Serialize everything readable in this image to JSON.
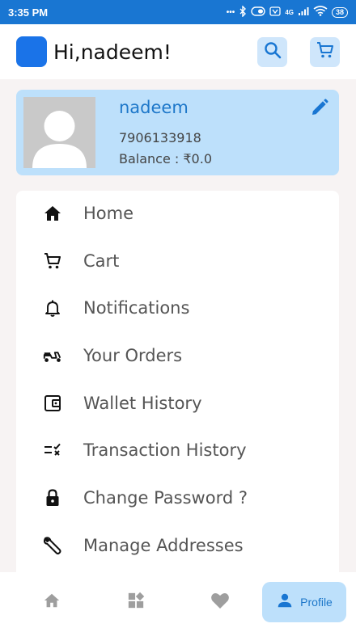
{
  "status_bar": {
    "time": "3:35 PM",
    "network": "4G",
    "battery": "38"
  },
  "app_bar": {
    "greeting": "Hi,nadeem!"
  },
  "profile": {
    "name": "nadeem",
    "phone": "7906133918",
    "balance": "Balance : ₹0.0"
  },
  "menu": {
    "items": [
      {
        "label": "Home",
        "icon": "home-icon"
      },
      {
        "label": "Cart",
        "icon": "cart-icon"
      },
      {
        "label": "Notifications",
        "icon": "bell-icon"
      },
      {
        "label": "Your Orders",
        "icon": "scooter-icon"
      },
      {
        "label": "Wallet History",
        "icon": "wallet-icon"
      },
      {
        "label": "Transaction History",
        "icon": "transaction-icon"
      },
      {
        "label": "Change Password ?",
        "icon": "lock-icon"
      },
      {
        "label": "Manage Addresses",
        "icon": "wrench-icon"
      }
    ]
  },
  "bottom_nav": {
    "items": [
      {
        "name": "home",
        "icon": "home-icon"
      },
      {
        "name": "categories",
        "icon": "grid-icon"
      },
      {
        "name": "favorites",
        "icon": "heart-icon"
      },
      {
        "name": "profile",
        "icon": "person-icon",
        "label": "Profile",
        "active": true
      }
    ]
  },
  "colors": {
    "primary": "#1976d2",
    "accent_blue": "#1d77c9",
    "light_blue": "#bde0fb",
    "logo_blue": "#1a73e8"
  }
}
